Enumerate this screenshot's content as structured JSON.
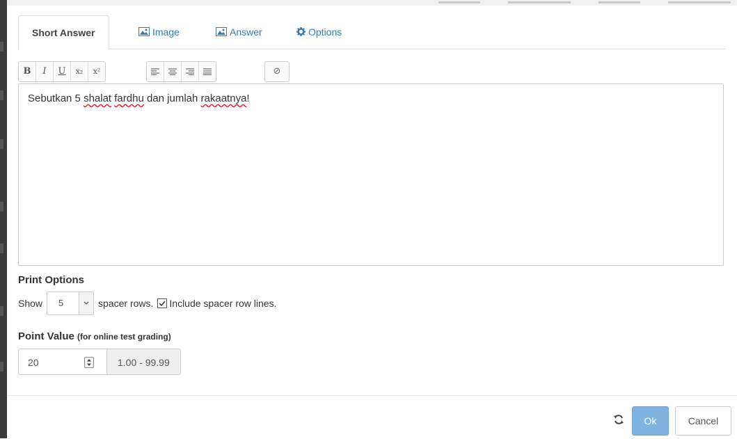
{
  "tabs": [
    {
      "label": "Short Answer",
      "icon": "none",
      "active": true
    },
    {
      "label": "Image",
      "icon": "image-icon",
      "active": false
    },
    {
      "label": "Answer",
      "icon": "image-icon",
      "active": false
    },
    {
      "label": "Options",
      "icon": "gear-icon",
      "active": false
    }
  ],
  "toolbar": {
    "bold": "B",
    "italic": "I",
    "underline": "U",
    "subscript": "x₂",
    "superscript": "x²",
    "clear": "⊘"
  },
  "editor": {
    "text_before": "Sebutkan 5 ",
    "word1": "shalat",
    "space1": " ",
    "word2": "fardhu",
    "text_mid": " dan jumlah ",
    "word3": "rakaatnya",
    "text_end": "!"
  },
  "print_options": {
    "heading": "Print Options",
    "show_label": "Show",
    "spacer_rows_value": "5",
    "spacer_rows_suffix": "spacer rows.",
    "include_lines_label": "Include spacer row lines.",
    "include_lines_checked": true
  },
  "point_value": {
    "heading": "Point Value",
    "note": "(for online test grading)",
    "value": "20",
    "range": "1.00 - 99.99"
  },
  "footer": {
    "ok_label": "Ok",
    "cancel_label": "Cancel"
  },
  "colors": {
    "link": "#337ab7",
    "ok_button": "#7fb3e0",
    "spellcheck": "#dd2233"
  }
}
